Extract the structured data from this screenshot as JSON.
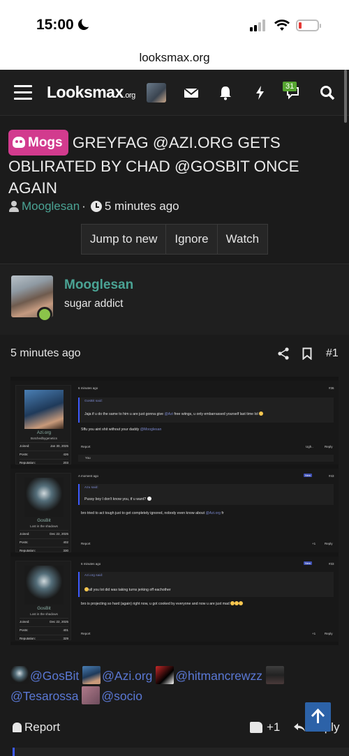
{
  "status": {
    "time": "15:00"
  },
  "browser": {
    "url": "looksmax.org"
  },
  "nav": {
    "logo_main": "Looksmax",
    "logo_suffix": ".org",
    "alerts_count": "31"
  },
  "thread": {
    "prefix": "Mogs",
    "title": "GREYFAG @AZI.ORG GETS OBLIRATED BY CHAD @GOSBIT ONCE AGAIN",
    "author": "Mooglesan",
    "separator": "·",
    "time": "5 minutes ago",
    "buttons": {
      "jump": "Jump to new",
      "ignore": "Ignore",
      "watch": "Watch"
    }
  },
  "post": {
    "username": "Mooglesan",
    "user_title": "sugar addict",
    "time": "5 minutes ago",
    "number": "#1",
    "report_label": "Report",
    "like_count": "+1",
    "reply_label": "Reply"
  },
  "embedded": {
    "posts": [
      {
        "username": "Azi.org",
        "user_title": "Botchedbygenetics",
        "joined_label": "Joined:",
        "joined": "Jan 30, 2025",
        "posts_label": "Posts:",
        "posts": "426",
        "rep_label": "Reputation:",
        "rep": "203",
        "time": "6 minutes ago",
        "num": "#36",
        "quote_author": "GosBit said:",
        "quote_text": "Jaja if u do the same to him u are just gonna give",
        "quote_mention": "@Azi",
        "quote_rest": "free wiings, u only embarrassed yourself last time lol",
        "body": "Sffu you aint shit without your daddy",
        "body_mention": "@Mooglesan",
        "report": "Report",
        "reaction": "Ugh..",
        "reply": "Reply",
        "you": "You"
      },
      {
        "username": "GosBit",
        "user_title": "Lost in the shadows",
        "joined_label": "Joined:",
        "joined": "Dec 22, 2025",
        "posts_label": "Posts:",
        "posts": "402",
        "rep_label": "Reputation:",
        "rep": "330",
        "time": "A moment ago",
        "new_label": "New",
        "num": "#43",
        "quote_author": "Azu said:",
        "quote_text": "Pussy boy I don't know you, tf u want?",
        "body": "bro tried to act tough just to get completely ignored, nobody even know about",
        "body_mention": "@Azi.org",
        "body_end": "fr",
        "report": "Report",
        "likes": "+1",
        "reply": "Reply"
      },
      {
        "username": "GosBit",
        "user_title": "Lost in the shadows",
        "joined_label": "Joined:",
        "joined": "Dec 22, 2025",
        "posts_label": "Posts:",
        "posts": "401",
        "rep_label": "Reputation:",
        "rep": "329",
        "time": "6 minutes ago",
        "new_label": "New",
        "num": "#33",
        "quote_author": "Azi.org said:",
        "quote_text": "all you lot did was taking turns jerking off eachother",
        "body": "bro is projecting so hard (again) right now, u got cooked by everyone and now u are just mad",
        "report": "Report",
        "likes": "+1",
        "reply": "Reply"
      }
    ]
  },
  "mentions": [
    "@GosBit",
    "@Azi.org",
    "@hitmancrewzz",
    "@Tesarossa",
    "@socio"
  ],
  "colors": {
    "accent_teal": "#4aa394",
    "prefix_pink": "#d23b8e",
    "mention_blue": "#5a78d4",
    "scroll_btn": "#2c62a8"
  }
}
